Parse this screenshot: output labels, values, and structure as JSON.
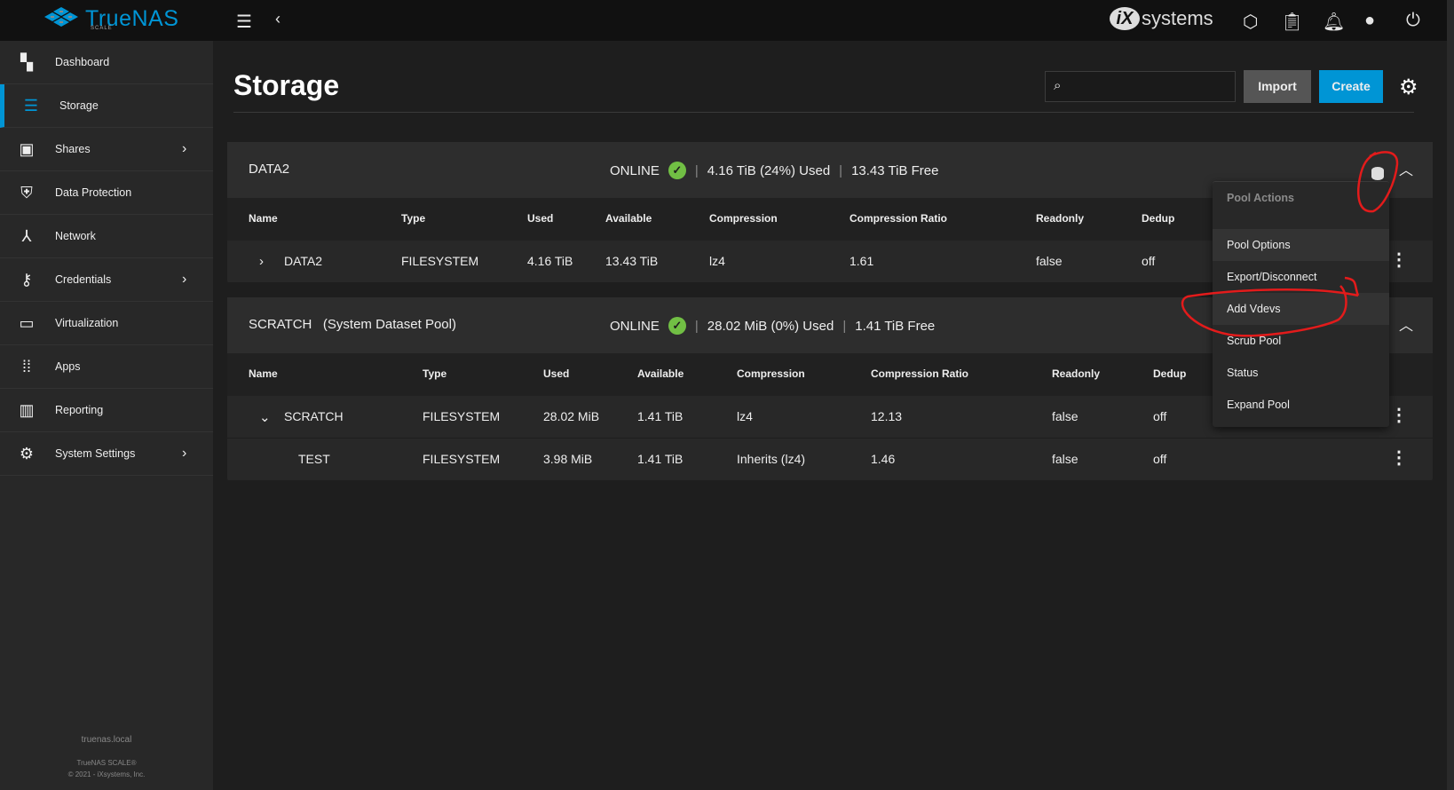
{
  "brand": {
    "name": "TrueNAS",
    "edition": "SCALE",
    "vendor": "systems",
    "vendor_mark": "iX"
  },
  "sidebar": {
    "items": [
      {
        "label": "Dashboard",
        "icon": "dashboard-icon",
        "chevron": false
      },
      {
        "label": "Storage",
        "icon": "storage-icon",
        "chevron": false,
        "active": true
      },
      {
        "label": "Shares",
        "icon": "shares-icon",
        "chevron": true
      },
      {
        "label": "Data Protection",
        "icon": "shield-icon",
        "chevron": false
      },
      {
        "label": "Network",
        "icon": "network-icon",
        "chevron": false
      },
      {
        "label": "Credentials",
        "icon": "key-icon",
        "chevron": true
      },
      {
        "label": "Virtualization",
        "icon": "laptop-icon",
        "chevron": false
      },
      {
        "label": "Apps",
        "icon": "apps-icon",
        "chevron": false
      },
      {
        "label": "Reporting",
        "icon": "chart-icon",
        "chevron": false
      },
      {
        "label": "System Settings",
        "icon": "gear-icon",
        "chevron": true
      }
    ],
    "hostname": "truenas.local",
    "product": "TrueNAS SCALE®",
    "copyright": "© 2021 - iXsystems, Inc."
  },
  "page": {
    "title": "Storage",
    "search_placeholder": "",
    "import_label": "Import",
    "create_label": "Create"
  },
  "pools": [
    {
      "name": "DATA2",
      "subtitle": "",
      "status": "ONLINE",
      "used": "4.16 TiB (24%) Used",
      "free": "13.43 TiB Free",
      "columns": [
        "Name",
        "Type",
        "Used",
        "Available",
        "Compression",
        "Compression Ratio",
        "Readonly",
        "Dedup"
      ],
      "rows": [
        [
          "DATA2",
          "FILESYSTEM",
          "4.16 TiB",
          "13.43 TiB",
          "lz4",
          "1.61",
          "false",
          "off"
        ]
      ]
    },
    {
      "name": "SCRATCH",
      "subtitle": "(System Dataset Pool)",
      "status": "ONLINE",
      "used": "28.02 MiB (0%) Used",
      "free": "1.41 TiB Free",
      "columns": [
        "Name",
        "Type",
        "Used",
        "Available",
        "Compression",
        "Compression Ratio",
        "Readonly",
        "Dedup"
      ],
      "rows": [
        [
          "SCRATCH",
          "FILESYSTEM",
          "28.02 MiB",
          "1.41 TiB",
          "lz4",
          "12.13",
          "false",
          "off"
        ],
        [
          "TEST",
          "FILESYSTEM",
          "3.98 MiB",
          "1.41 TiB",
          "Inherits (lz4)",
          "1.46",
          "false",
          "off"
        ]
      ]
    }
  ],
  "menu": {
    "header": "Pool Actions",
    "items": [
      "Pool Options",
      "Export/Disconnect",
      "Add Vdevs",
      "Scrub Pool",
      "Status",
      "Expand Pool"
    ]
  },
  "colors": {
    "accent": "#0095d5",
    "online": "#71bf44",
    "annotation": "#e31b1b"
  }
}
